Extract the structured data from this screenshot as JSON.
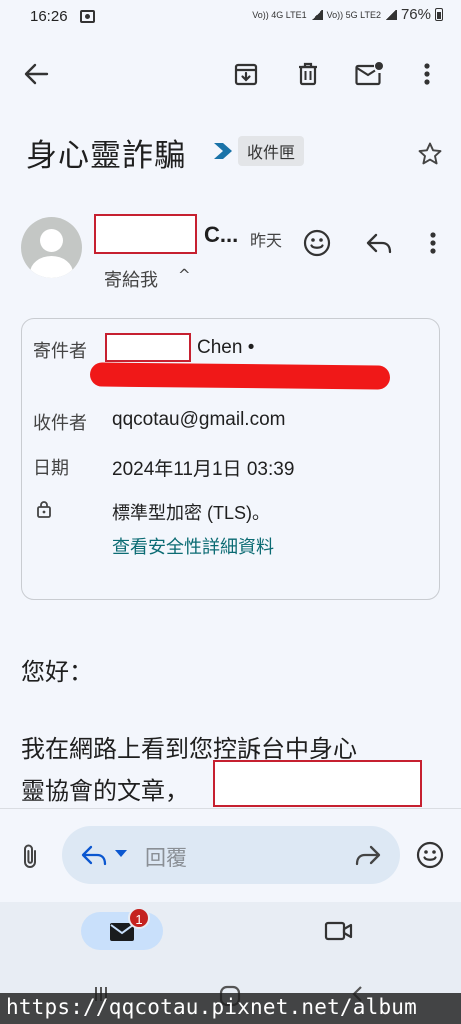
{
  "status_bar": {
    "time": "16:26",
    "lte1": "Vo)) 4G LTE1",
    "lte2": "Vo)) 5G LTE2",
    "battery": "76%"
  },
  "email": {
    "subject": "身心靈詐騙",
    "label": "收件匣",
    "sender_name": "C...",
    "sender_time": "昨天",
    "to_me": "寄給我",
    "to_me_chevron": "^"
  },
  "details": {
    "from_label": "寄件者",
    "from_name": "Chen •",
    "to_label": "收件者",
    "to_value": "qqcotau@gmail.com",
    "date_label": "日期",
    "date_value": "2024年11月1日 03:39",
    "security_value": "標準型加密 (TLS)。",
    "security_link": "查看安全性詳細資料"
  },
  "body": {
    "greeting": "您好：",
    "para_line1": "我在網路上看到您控訴台中身心",
    "para_line2": "靈協會的文章，"
  },
  "reply_bar": {
    "placeholder": "回覆"
  },
  "bottom_nav": {
    "mail_badge": "1"
  },
  "watermark": "https://qqcotau.pixnet.net/album",
  "colors": {
    "background": "#f3f6fc",
    "accent": "#0b57d0",
    "link": "#0b6b73",
    "redaction": "#c62030",
    "scribble": "#f01818",
    "badge": "#c5221f"
  },
  "icons": [
    "back-arrow-icon",
    "archive-icon",
    "trash-icon",
    "mark-unread-icon",
    "more-vert-icon",
    "label-arrow-icon",
    "star-icon",
    "avatar-icon",
    "emoji-icon",
    "reply-icon",
    "lock-icon",
    "attach-icon",
    "forward-icon",
    "mail-icon",
    "video-icon"
  ]
}
